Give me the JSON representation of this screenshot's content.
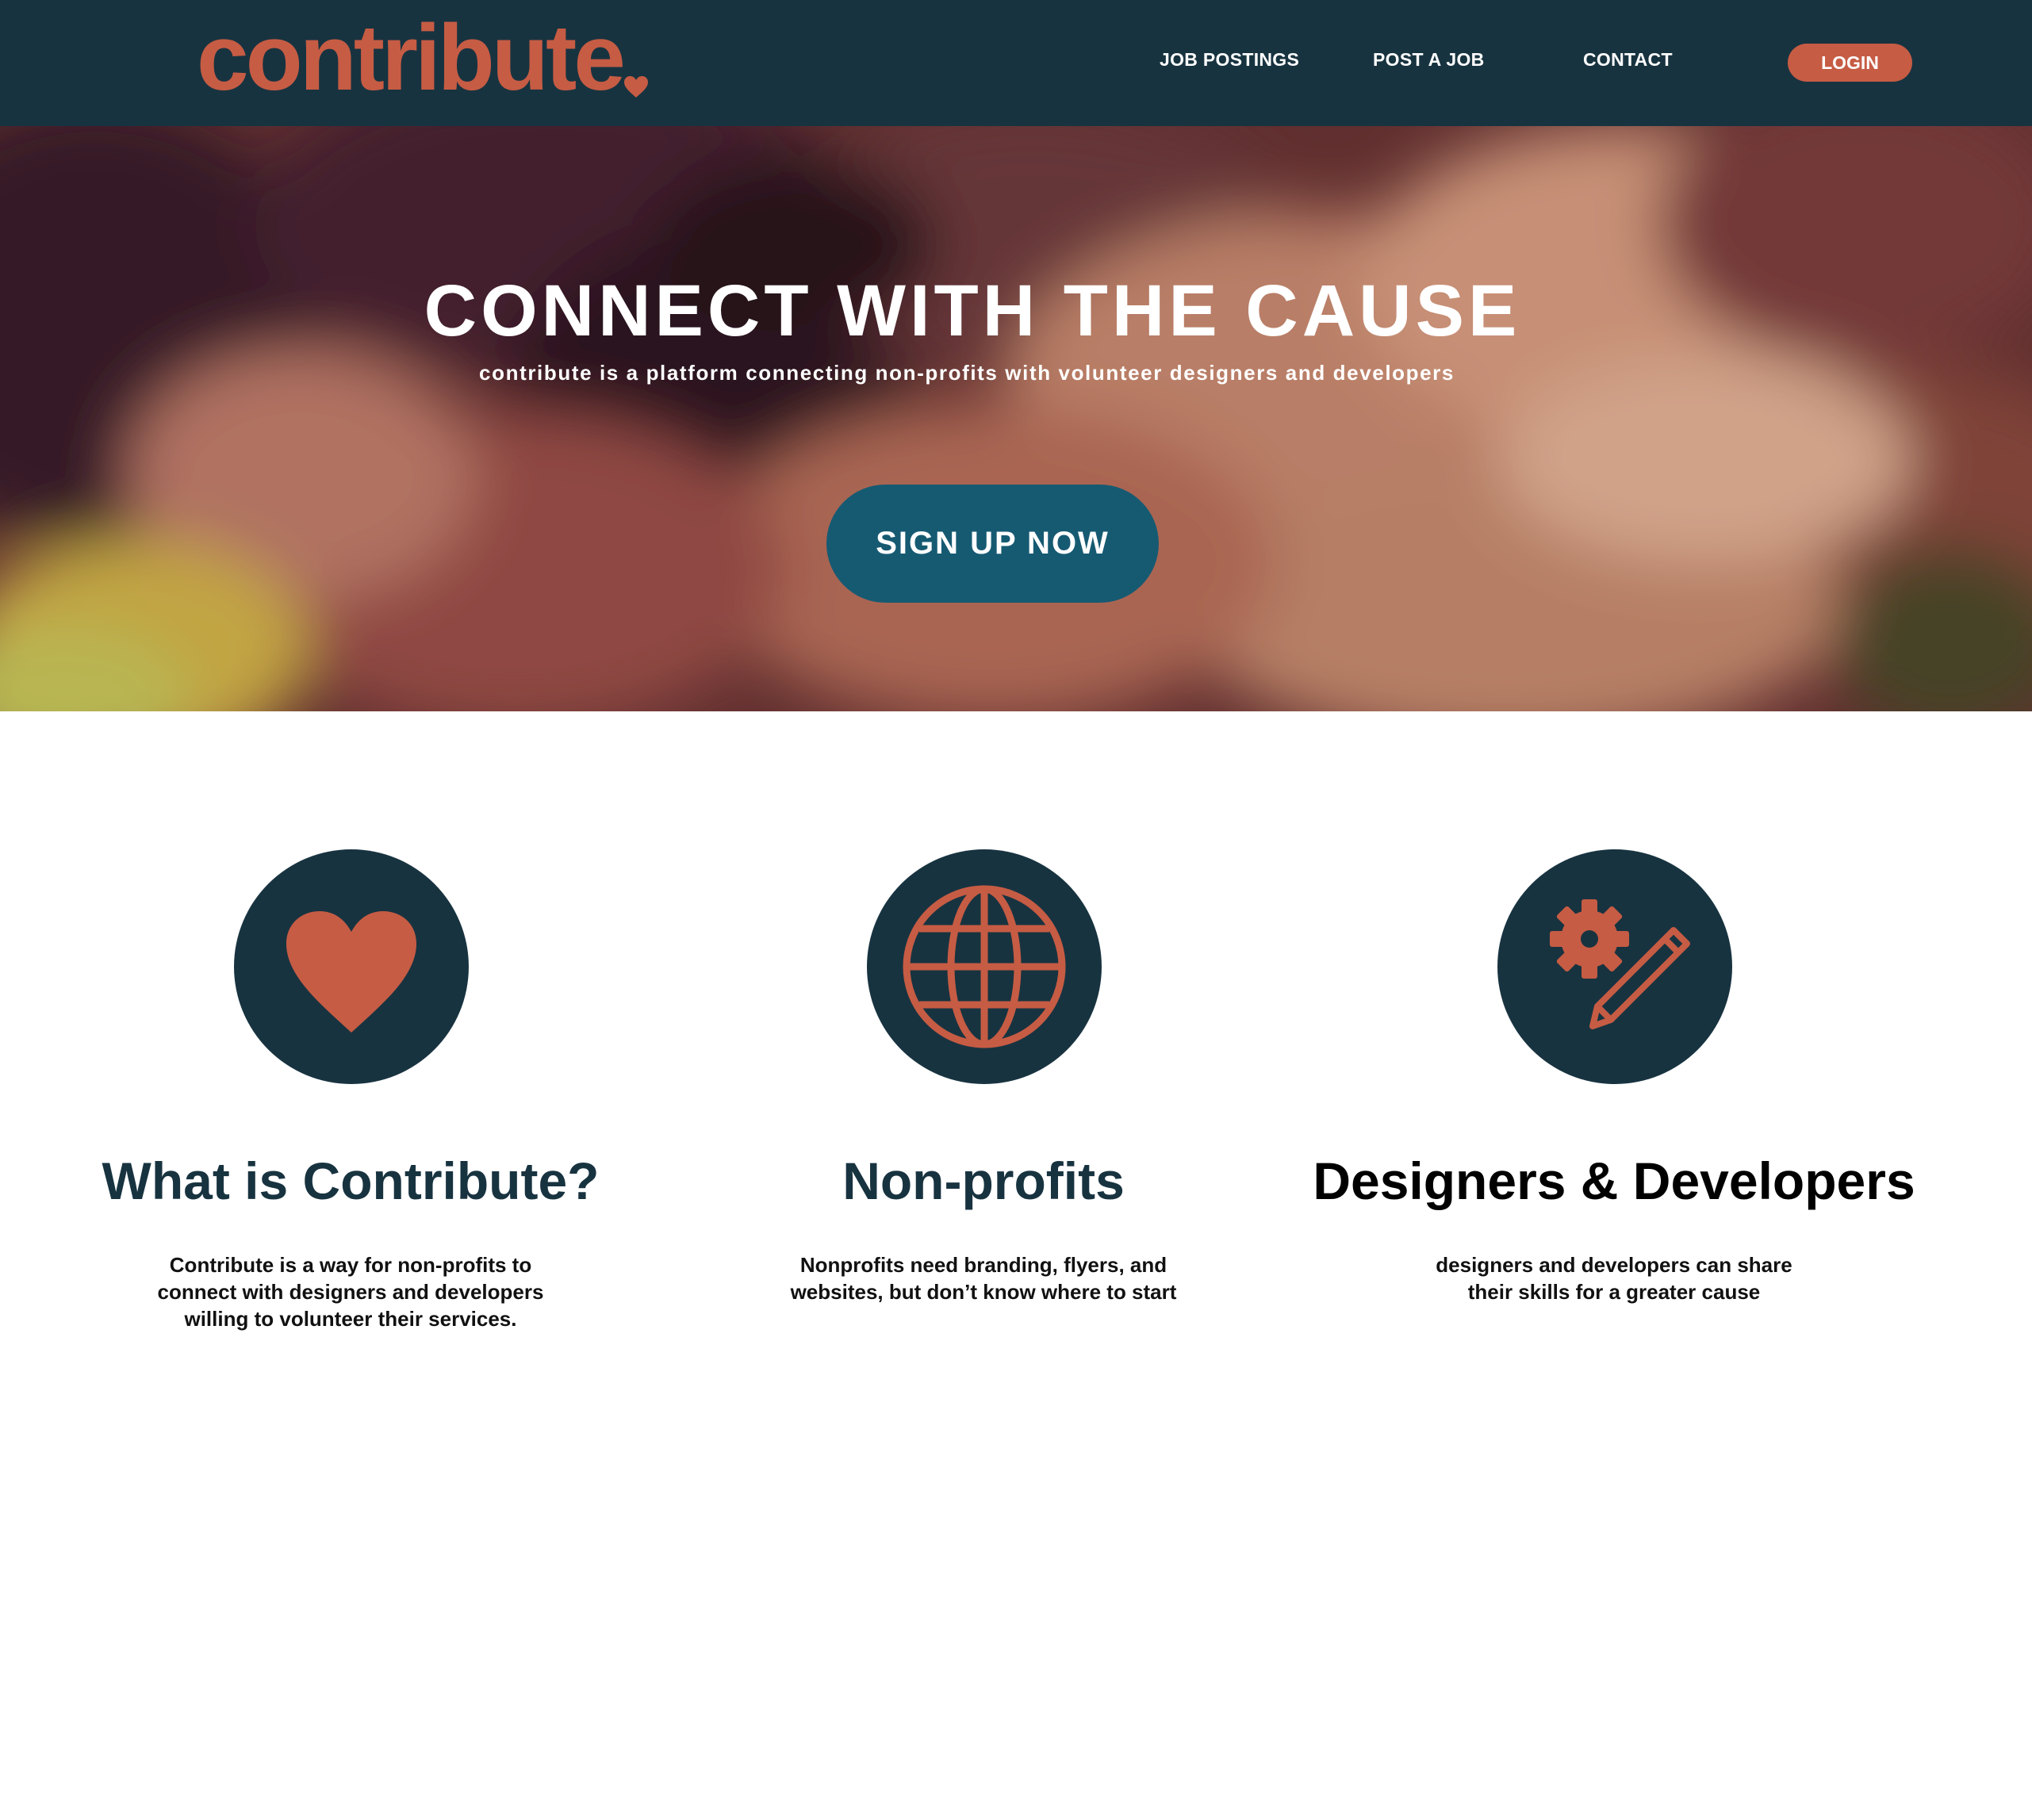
{
  "header": {
    "logo_text": "contribute",
    "nav": {
      "job_postings": "JOB POSTINGS",
      "post_a_job": "POST A JOB",
      "contact": "CONTACT",
      "login": "LOGIN"
    }
  },
  "hero": {
    "title": "CONNECT WITH THE CAUSE",
    "subtitle": "contribute is a platform connecting non-profits with volunteer designers and developers",
    "cta_label": "SIGN UP NOW"
  },
  "features": [
    {
      "icon": "heart-icon",
      "title": "What is Contribute?",
      "description": "Contribute is a way for non-profits to connect with designers and developers willing to volunteer their services."
    },
    {
      "icon": "globe-icon",
      "title": "Non-profits",
      "description": "Nonprofits need branding, flyers, and websites, but don’t know where to start"
    },
    {
      "icon": "gear-pencil-icon",
      "title": "Designers & Developers",
      "description": "designers and developers can share their skills for a greater cause"
    }
  ],
  "colors": {
    "navy": "#183340",
    "accent": "#c65c44",
    "button_teal": "#165a72",
    "background": "#ffffff"
  }
}
